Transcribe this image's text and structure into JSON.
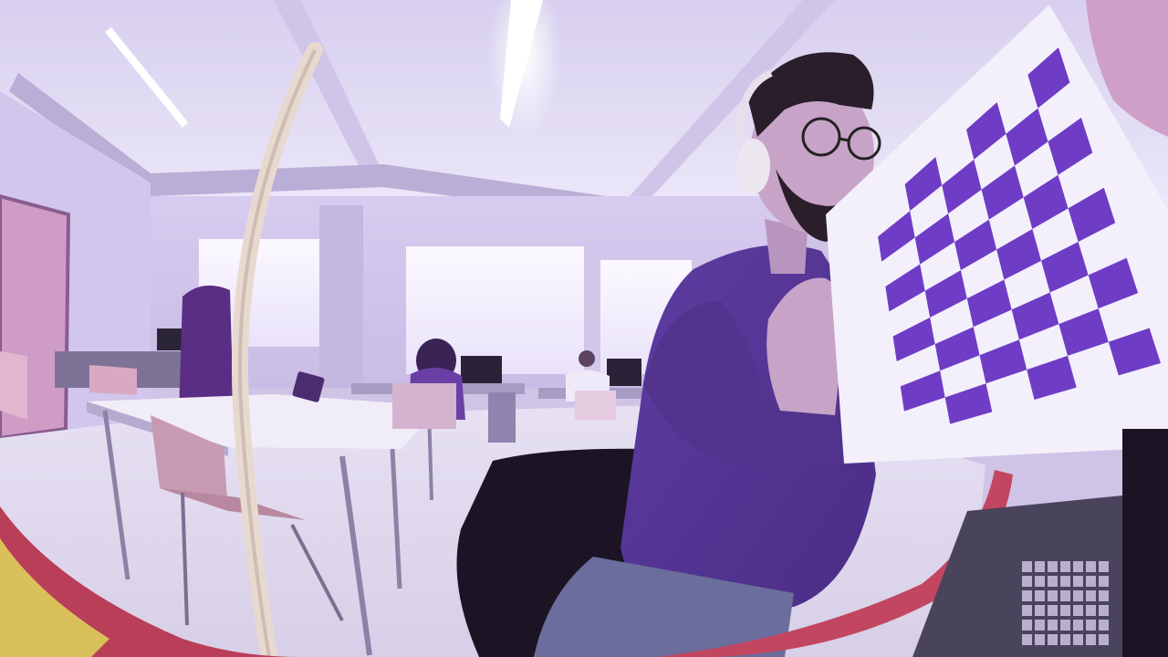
{
  "scene": {
    "description_free": true,
    "palette": {
      "ceiling": "#e6e0f6",
      "wall": "#d9d0ef",
      "window_glow": "#f4f0ff",
      "floor": "#e3ddf1",
      "sweater": "#5a3b9a",
      "checker_dark": "#6f3cc6",
      "checker_light": "#f3f0fb",
      "red_rim": "#b93e58",
      "hair": "#2b1e2b",
      "skin": "#c8a3c8"
    },
    "checkerboard": {
      "rows": 9,
      "cols": 6
    }
  }
}
